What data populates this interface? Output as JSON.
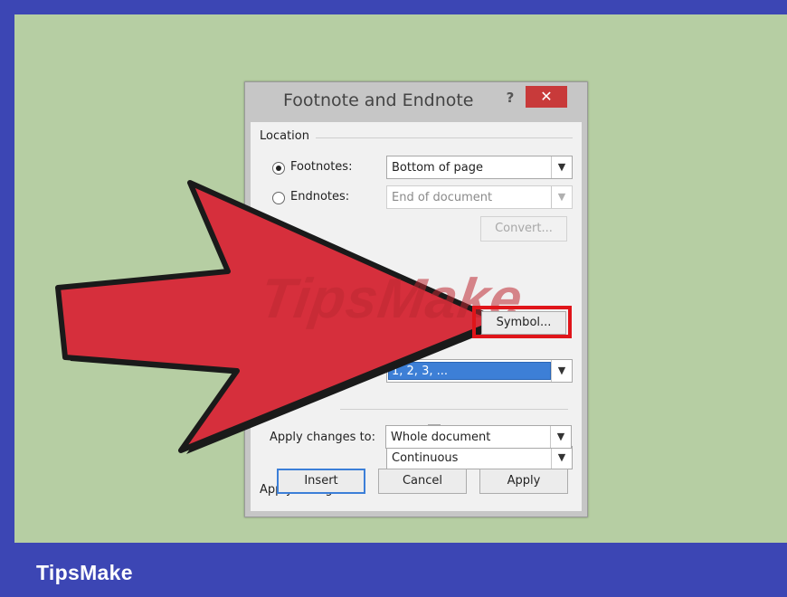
{
  "dialog": {
    "title": "Footnote and Endnote",
    "help": "?",
    "close": "✕"
  },
  "location": {
    "heading": "Location",
    "footnotes_label": "Footnotes:",
    "footnotes_value": "Bottom of page",
    "endnotes_label": "Endnotes:",
    "endnotes_value": "End of document",
    "convert_label": "Convert...",
    "selected": "footnotes"
  },
  "format": {
    "number_format_value": "1, 2, 3, ...",
    "symbol_label": "Symbol...",
    "numbering_value": "Continuous"
  },
  "apply_changes": {
    "heading": "Apply changes",
    "apply_to_label": "Apply changes to:",
    "apply_to_value": "Whole document"
  },
  "actions": {
    "insert": "Insert",
    "cancel": "Cancel",
    "apply": "Apply"
  },
  "watermark": "TipsMake",
  "brand": "TipsMake",
  "colors": {
    "background": "#b6cea3",
    "frame": "#3c46b4",
    "arrow_fill": "#d62f3c",
    "highlight_box": "#e0151a"
  },
  "icons": {
    "dropdown": "chevron-down-icon",
    "help": "help-icon",
    "close": "close-icon"
  }
}
